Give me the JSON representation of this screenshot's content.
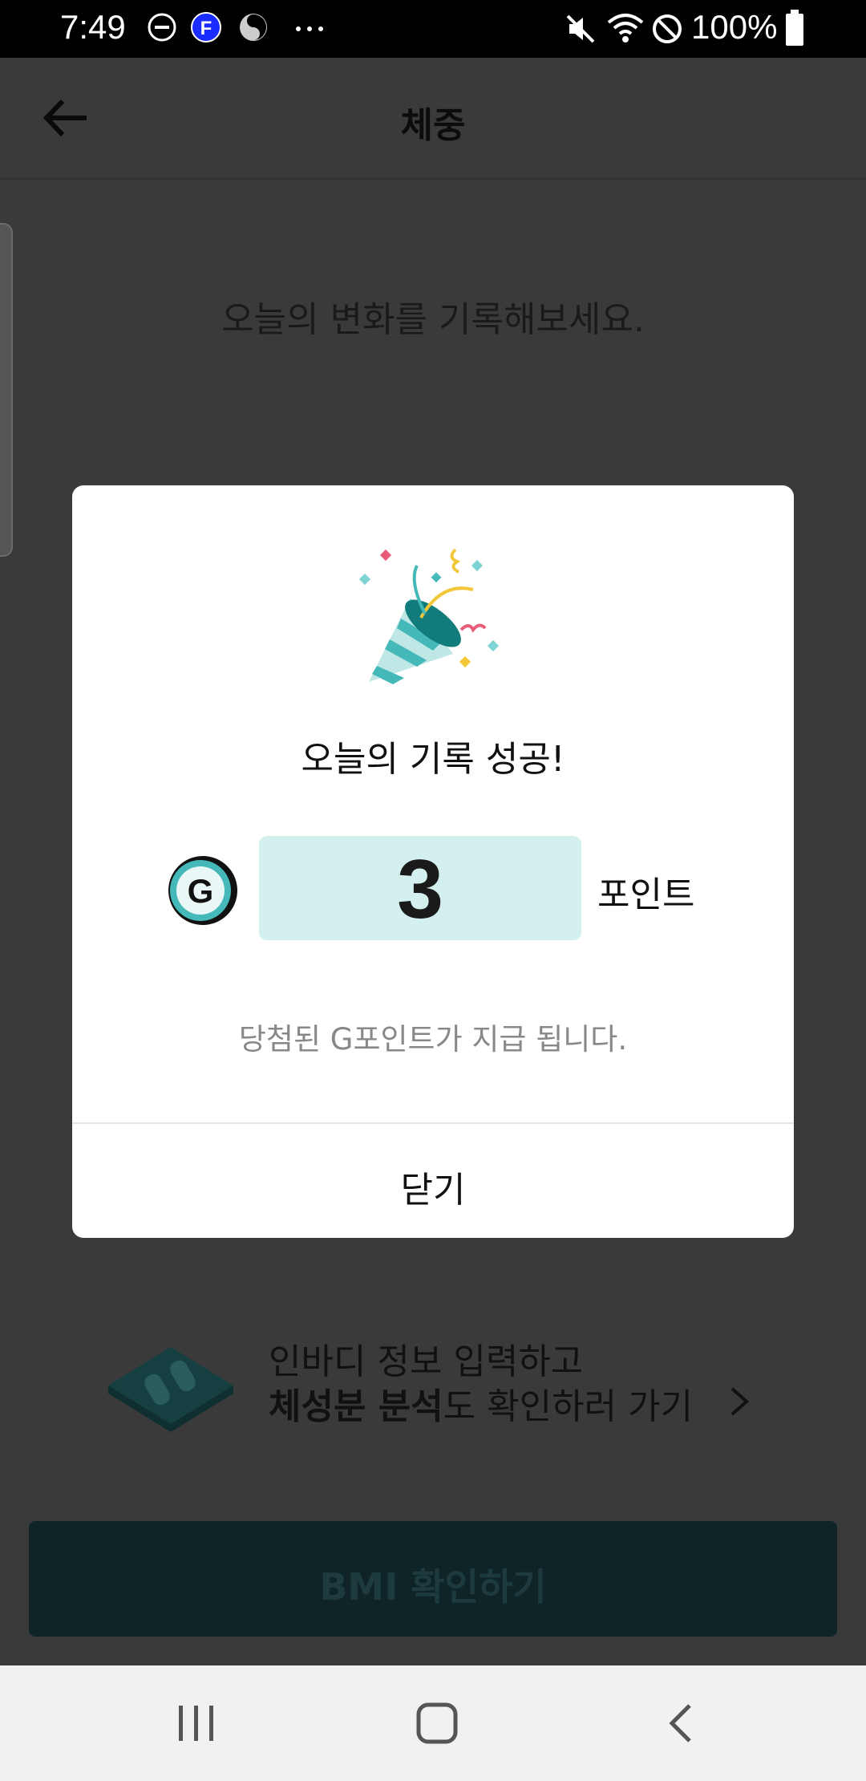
{
  "status_bar": {
    "time": "7:49",
    "battery": "100%"
  },
  "app_bar": {
    "title": "체중"
  },
  "page": {
    "prompt": "오늘의 변화를 기록해보세요."
  },
  "promo": {
    "line1": "인바디 정보 입력하고",
    "line2_bold": "체성분 분석",
    "line2_rest": "도 확인하러 가기"
  },
  "bmi_button": {
    "label": "BMI 확인하기"
  },
  "dialog": {
    "title": "오늘의 기록 성공!",
    "points_value": "3",
    "points_unit": "포인트",
    "note": "당첨된 G포인트가 지급 됩니다.",
    "close_label": "닫기"
  },
  "colors": {
    "accent": "#3fb6b8",
    "points_bg": "#d3f0ef",
    "dim_bg": "#3a3a3a",
    "bmi_bg": "#0e2426"
  }
}
